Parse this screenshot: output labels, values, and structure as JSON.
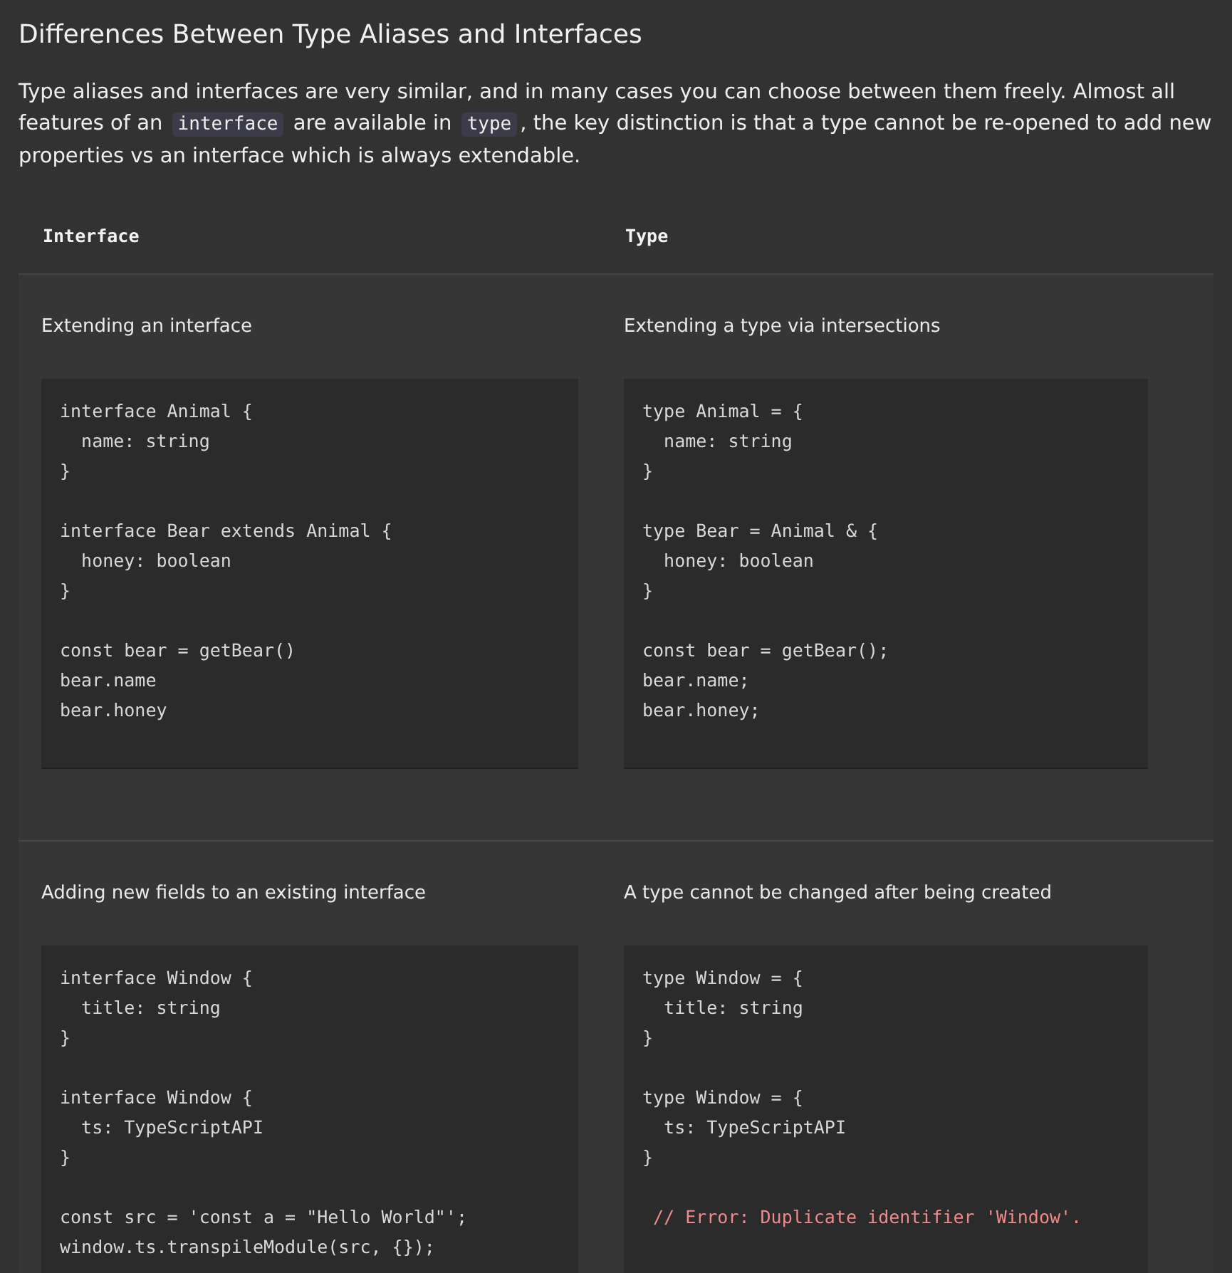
{
  "title": "Differences Between Type Aliases and Interfaces",
  "intro": [
    {
      "kind": "text",
      "text": "Type aliases and interfaces are very similar, and in many cases you can choose between them freely. Almost all features of an "
    },
    {
      "kind": "code",
      "text": "interface"
    },
    {
      "kind": "text",
      "text": " are available in "
    },
    {
      "kind": "code",
      "text": "type"
    },
    {
      "kind": "text",
      "text": ", the key distinction is that a type cannot be re-opened to add new properties vs an interface which is always extendable."
    }
  ],
  "table": {
    "columns": [
      "Interface",
      "Type"
    ],
    "rows": [
      {
        "cells": [
          {
            "label": "Extending an interface",
            "code": [
              {
                "kind": "code",
                "lines": [
                  "interface Animal {",
                  "  name: string",
                  "}"
                ]
              },
              {
                "kind": "code",
                "lines": [
                  "interface Bear extends Animal {",
                  "  honey: boolean",
                  "}"
                ]
              },
              {
                "kind": "code",
                "lines": [
                  "const bear = getBear()",
                  "bear.name",
                  "bear.honey"
                ]
              }
            ]
          },
          {
            "label": "Extending a type via intersections",
            "code": [
              {
                "kind": "code",
                "lines": [
                  "type Animal = {",
                  "  name: string",
                  "}"
                ]
              },
              {
                "kind": "code",
                "lines": [
                  "type Bear = Animal & {",
                  "  honey: boolean",
                  "}"
                ]
              },
              {
                "kind": "code",
                "lines": [
                  "const bear = getBear();",
                  "bear.name;",
                  "bear.honey;"
                ]
              }
            ]
          }
        ]
      },
      {
        "cells": [
          {
            "label": "Adding new fields to an existing interface",
            "code": [
              {
                "kind": "code",
                "lines": [
                  "interface Window {",
                  "  title: string",
                  "}"
                ]
              },
              {
                "kind": "code",
                "lines": [
                  "interface Window {",
                  "  ts: TypeScriptAPI",
                  "}"
                ]
              },
              {
                "kind": "code",
                "lines": [
                  "const src = 'const a = \"Hello World\"';",
                  "window.ts.transpileModule(src, {});"
                ]
              }
            ]
          },
          {
            "label": "A type cannot be changed after being created",
            "code": [
              {
                "kind": "code",
                "lines": [
                  "type Window = {",
                  "  title: string",
                  "}"
                ]
              },
              {
                "kind": "code",
                "lines": [
                  "type Window = {",
                  "  ts: TypeScriptAPI",
                  "}"
                ]
              },
              {
                "kind": "error",
                "lines": [
                  " // Error: Duplicate identifier 'Window'."
                ]
              }
            ]
          }
        ]
      }
    ]
  }
}
